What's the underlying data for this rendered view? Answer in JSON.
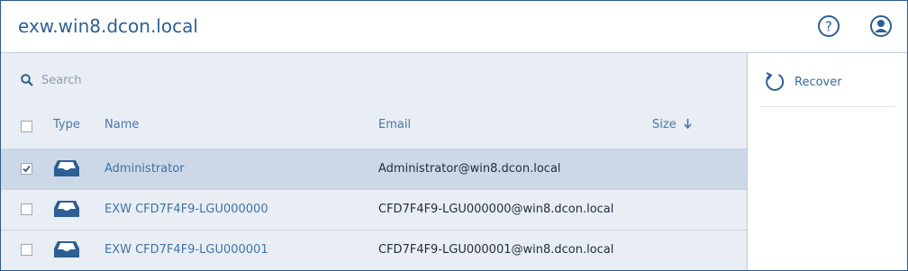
{
  "header": {
    "title": "exw.win8.dcon.local",
    "help_icon": "help-circle-icon",
    "user_icon": "user-account-icon"
  },
  "search": {
    "placeholder": "Search",
    "value": ""
  },
  "table": {
    "columns": {
      "type": "Type",
      "name": "Name",
      "email": "Email",
      "size": "Size"
    },
    "sort_column": "size",
    "sort_direction": "descending",
    "rows": [
      {
        "type_icon": "mailbox-icon",
        "name": "Administrator",
        "email": "Administrator@win8.dcon.local",
        "size": "",
        "checked": true,
        "selected": true
      },
      {
        "type_icon": "mailbox-icon",
        "name": "EXW CFD7F4F9-LGU000000",
        "email": "CFD7F4F9-LGU000000@win8.dcon.local",
        "size": "",
        "checked": false,
        "selected": false
      },
      {
        "type_icon": "mailbox-icon",
        "name": "EXW CFD7F4F9-LGU000001",
        "email": "CFD7F4F9-LGU000001@win8.dcon.local",
        "size": "",
        "checked": false,
        "selected": false
      }
    ]
  },
  "actions": {
    "recover_label": "Recover",
    "recover_icon": "recover-icon"
  },
  "colors": {
    "accent": "#2c5f93",
    "link": "#4173a5",
    "list_background": "#e9edf4",
    "selected_row": "#ccd8e7"
  }
}
